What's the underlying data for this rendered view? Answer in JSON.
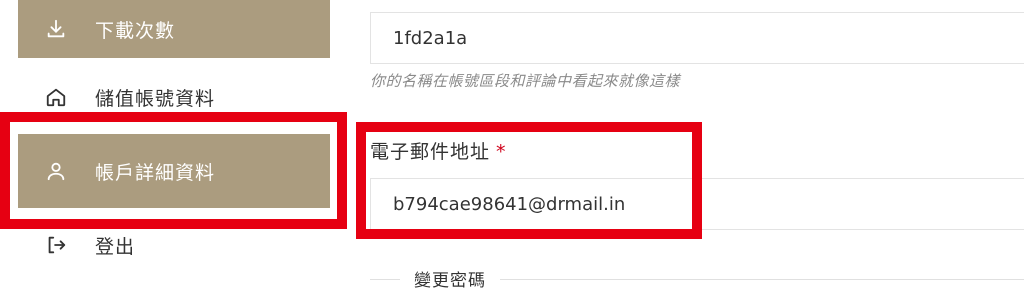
{
  "sidebar": {
    "items": [
      {
        "label": "下載次數",
        "icon": "download-icon",
        "active": true
      },
      {
        "label": "儲值帳號資料",
        "icon": "home-icon",
        "active": false
      },
      {
        "label": "帳戶詳細資料",
        "icon": "user-icon",
        "active": true
      },
      {
        "label": "登出",
        "icon": "logout-icon",
        "active": false
      }
    ]
  },
  "form": {
    "display_name_value": "1fd2a1a",
    "display_name_hint": "你的名稱在帳號區段和評論中看起來就像這樣",
    "email_label": "電子郵件地址",
    "email_required_mark": "*",
    "email_value": "b794cae98641@drmail.in",
    "password_section_title": "變更密碼"
  },
  "colors": {
    "active_bg": "#ab9c7f",
    "highlight_border": "#e60012",
    "required": "#d0021b"
  }
}
